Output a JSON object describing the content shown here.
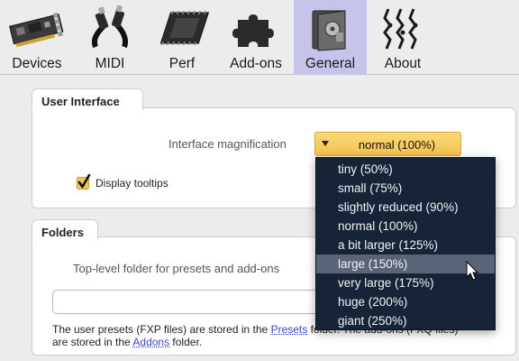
{
  "toolbar": {
    "tabs": [
      {
        "label": "Devices",
        "icon": "sound-card-icon"
      },
      {
        "label": "MIDI",
        "icon": "midi-connector-icon"
      },
      {
        "label": "Perf",
        "icon": "cpu-chip-icon"
      },
      {
        "label": "Add-ons",
        "icon": "puzzle-piece-icon"
      },
      {
        "label": "General",
        "icon": "folder-icon"
      },
      {
        "label": "About",
        "icon": "signal-wave-icon"
      }
    ],
    "active": "General"
  },
  "user_interface": {
    "title": "User Interface",
    "magnification_label": "Interface magnification",
    "magnification_value": "normal (100%)",
    "tooltips_label": "Display tooltips",
    "tooltips_checked": true
  },
  "folders": {
    "title": "Folders",
    "top_level_label": "Top-level folder for presets and add-ons",
    "path_value": "",
    "note_line1_pre": "The user presets (FXP files) are stored in the ",
    "note_link1": "Presets",
    "note_line1_post": " folder. The add-ons (FXQ files)",
    "note_line2_pre": "are stored in the ",
    "note_link2": "Addons",
    "note_line2_post": " folder."
  },
  "dropdown": {
    "options": [
      "tiny (50%)",
      "small (75%)",
      "slightly reduced (90%)",
      "normal (100%)",
      "a bit larger (125%)",
      "large (150%)",
      "very large (175%)",
      "huge (200%)",
      "giant (250%)"
    ],
    "highlighted": "large (150%)"
  },
  "colors": {
    "active_tab": "#c6c4ea",
    "combo": "#f4c14f",
    "dropdown_bg": "#172438",
    "dropdown_highlight": "#5a6477",
    "link": "#3a48c8"
  }
}
